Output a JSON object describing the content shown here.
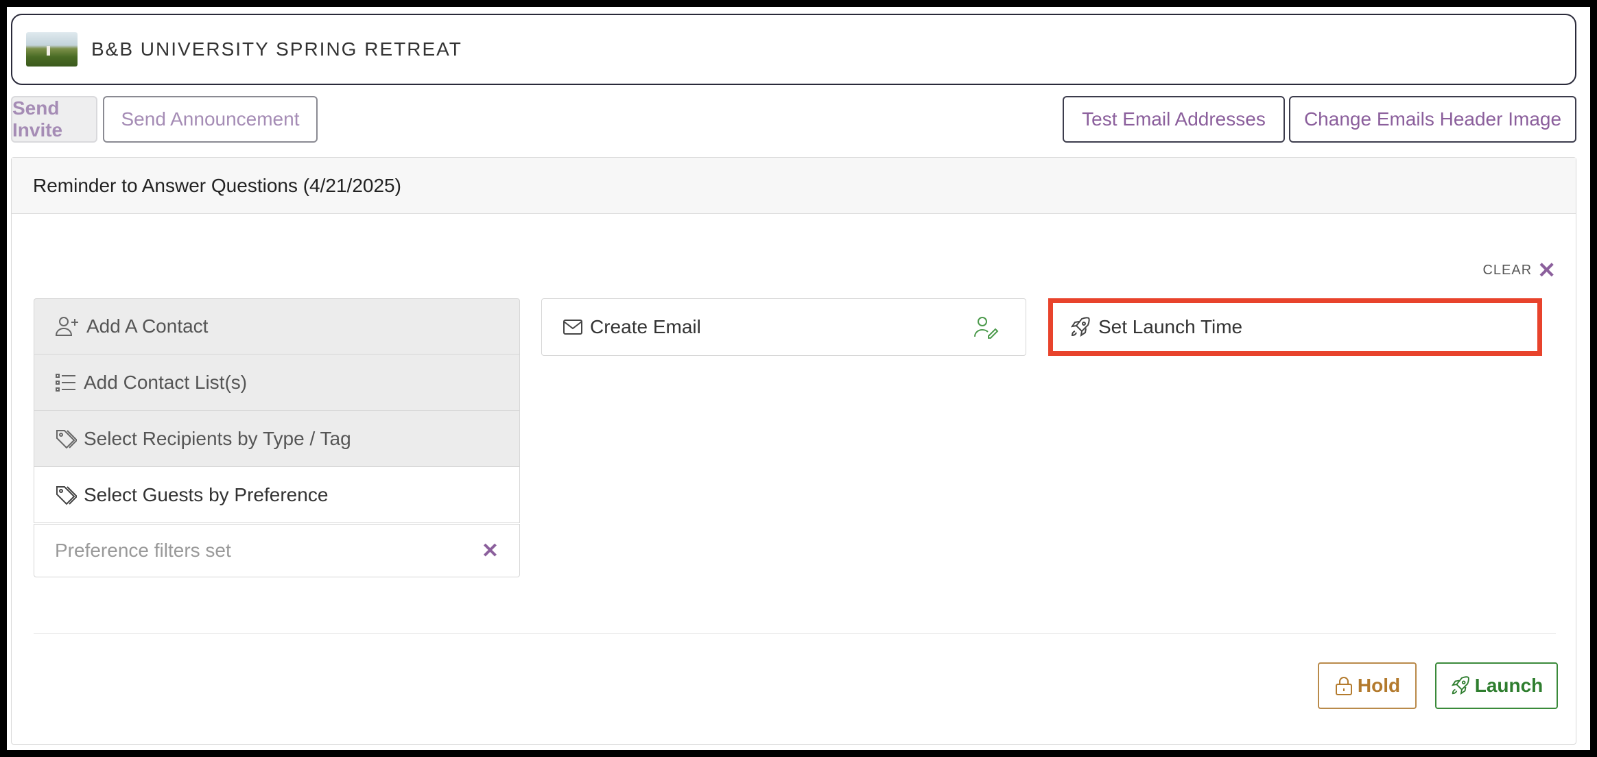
{
  "event": {
    "title": "B&B UNIVERSITY SPRING RETREAT"
  },
  "toolbar": {
    "send_invite": "Send Invite",
    "send_announcement": "Send Announcement",
    "test_emails": "Test Email Addresses",
    "change_header": "Change Emails Header Image"
  },
  "panel": {
    "title": "Reminder to Answer Questions (4/21/2025)",
    "clear_label": "CLEAR",
    "recipients": {
      "items": [
        {
          "label": "Add A Contact",
          "icon": "add-user-icon"
        },
        {
          "label": "Add Contact List(s)",
          "icon": "list-icon"
        },
        {
          "label": "Select Recipients by Type / Tag",
          "icon": "tag-icon"
        },
        {
          "label": "Select Guests by Preference",
          "icon": "tag-icon"
        }
      ],
      "filter_placeholder": "Preference filters set"
    },
    "create_email": "Create Email",
    "set_launch_time": "Set Launch Time",
    "hold": "Hold",
    "launch": "Launch"
  },
  "colors": {
    "accent": "#8b5f9c",
    "highlight": "#e8432c",
    "hold": "#b37a2d",
    "launch": "#2e7d2e",
    "edit_icon": "#4c9a4c"
  }
}
